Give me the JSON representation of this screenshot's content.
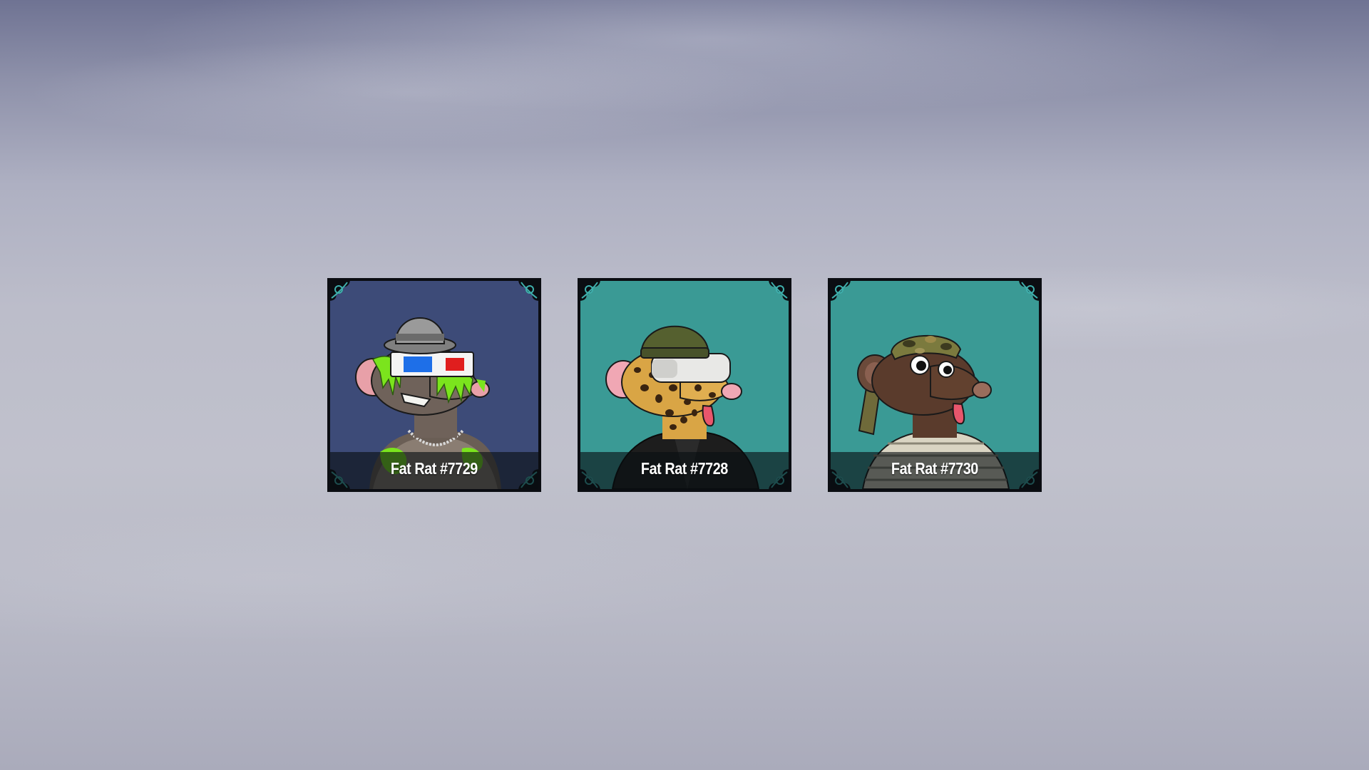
{
  "cards": [
    {
      "title": "Fat Rat #7729",
      "background": "#3d4b78",
      "icon": "rat-with-3d-glasses-and-bowler-hat"
    },
    {
      "title": "Fat Rat #7728",
      "background": "#3a9a95",
      "icon": "rat-with-leopard-fur-and-vr-headset"
    },
    {
      "title": "Fat Rat #7730",
      "background": "#3a9a95",
      "icon": "rat-with-camo-bandana"
    }
  ],
  "colors": {
    "frame": "#0b0d12",
    "corner_ornament": "#3fb0ad"
  }
}
